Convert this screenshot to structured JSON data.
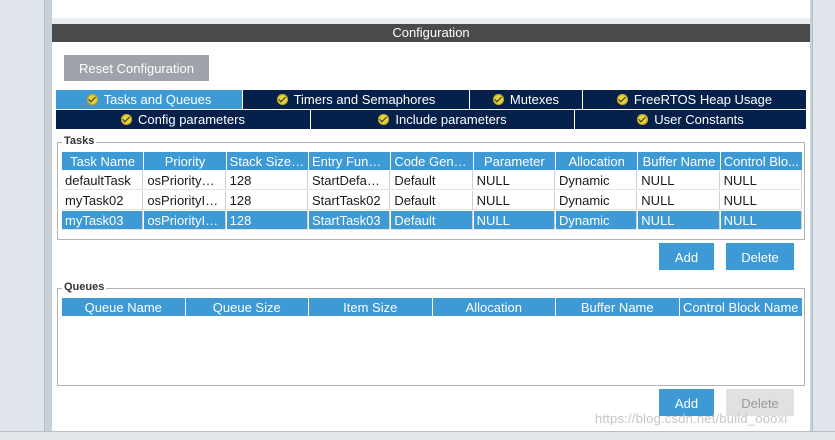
{
  "config_header": "Configuration",
  "reset_button": "Reset Configuration",
  "tabs_row1": [
    {
      "label": "Tasks and Queues",
      "active": true
    },
    {
      "label": "Timers and Semaphores",
      "active": false
    },
    {
      "label": "Mutexes",
      "active": false
    },
    {
      "label": "FreeRTOS Heap Usage",
      "active": false
    }
  ],
  "tabs_row2": [
    {
      "label": "Config parameters",
      "active": false
    },
    {
      "label": "Include parameters",
      "active": false
    },
    {
      "label": "User Constants",
      "active": false
    }
  ],
  "tasks": {
    "title": "Tasks",
    "columns": [
      "Task Name",
      "Priority",
      "Stack Size ...",
      "Entry Funct...",
      "Code Gene...",
      "Parameter",
      "Allocation",
      "Buffer Name",
      "Control Blo..."
    ],
    "rows": [
      [
        "defaultTask",
        "osPriorityN...",
        "128",
        "StartDefault...",
        "Default",
        "NULL",
        "Dynamic",
        "NULL",
        "NULL"
      ],
      [
        "myTask02",
        "osPriorityIdle",
        "128",
        "StartTask02",
        "Default",
        "NULL",
        "Dynamic",
        "NULL",
        "NULL"
      ],
      [
        "myTask03",
        "osPriorityIdle",
        "128",
        "StartTask03",
        "Default",
        "NULL",
        "Dynamic",
        "NULL",
        "NULL"
      ]
    ],
    "selected_row": 2,
    "add_label": "Add",
    "delete_label": "Delete"
  },
  "queues": {
    "title": "Queues",
    "columns": [
      "Queue Name",
      "Queue Size",
      "Item Size",
      "Allocation",
      "Buffer Name",
      "Control Block Name"
    ],
    "rows": [],
    "add_label": "Add",
    "delete_label": "Delete"
  },
  "watermark": "https://blog.csdn.net/build_oooxi"
}
